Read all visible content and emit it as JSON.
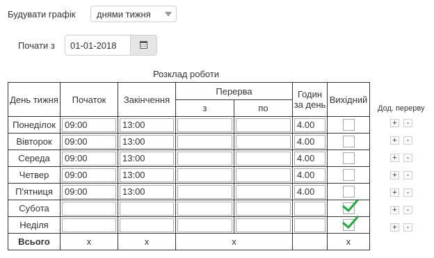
{
  "build": {
    "label": "Будувати графік",
    "selected": "днями тижня"
  },
  "start": {
    "label": "Почати з",
    "date": "01-01-2018"
  },
  "schedule": {
    "caption": "Розклад роботи",
    "headers": {
      "day": "День тижня",
      "start": "Початок",
      "end": "Закінчення",
      "break": "Перерва",
      "break_from": "з",
      "break_to": "по",
      "hours": "Годин за день",
      "dayoff": "Вихідний"
    },
    "rows": [
      {
        "day": "Понеділок",
        "start": "09:00",
        "end": "13:00",
        "from": "",
        "to": "",
        "hours": "4.00",
        "dayoff": false
      },
      {
        "day": "Вівторок",
        "start": "09:00",
        "end": "13:00",
        "from": "",
        "to": "",
        "hours": "4.00",
        "dayoff": false
      },
      {
        "day": "Середа",
        "start": "09:00",
        "end": "13:00",
        "from": "",
        "to": "",
        "hours": "4.00",
        "dayoff": false
      },
      {
        "day": "Четвер",
        "start": "09:00",
        "end": "13:00",
        "from": "",
        "to": "",
        "hours": "4.00",
        "dayoff": false
      },
      {
        "day": "П'ятниця",
        "start": "09:00",
        "end": "13:00",
        "from": "",
        "to": "",
        "hours": "4.00",
        "dayoff": false
      },
      {
        "day": "Субота",
        "start": "",
        "end": "",
        "from": "",
        "to": "",
        "hours": "",
        "dayoff": true
      },
      {
        "day": "Неділя",
        "start": "",
        "end": "",
        "from": "",
        "to": "",
        "hours": "",
        "dayoff": true
      }
    ],
    "total": {
      "label": "Всього",
      "start": "x",
      "end": "x",
      "break": "x",
      "hours": "",
      "dayoff": "x"
    }
  },
  "extra_break": {
    "title": "Дод. перерву",
    "add": "+",
    "remove": "-"
  },
  "colors": {
    "check": "#2aa84a",
    "border": "#333333"
  }
}
